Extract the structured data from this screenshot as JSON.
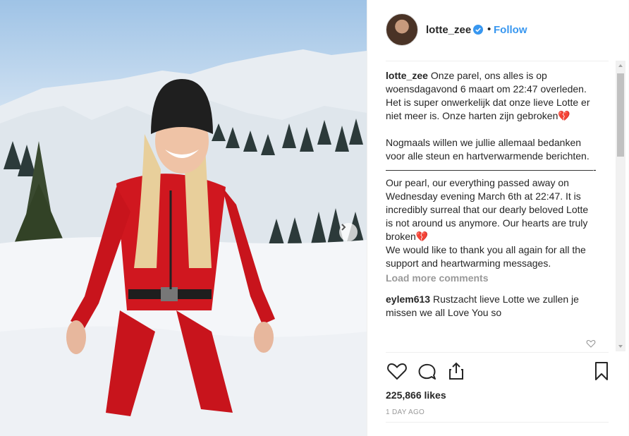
{
  "post": {
    "username": "lotte_zee",
    "follow_label": "Follow",
    "separator": "•",
    "caption": "Onze parel, ons alles is op woensdagavond 6 maart om 22:47 overleden. Het is super onwerkelijk dat onze lieve Lotte er niet meer is. Onze harten zijn gebroken💔\n\nNogmaals willen we jullie allemaal bedanken voor alle steun en hartverwarmende berichten.\n—————————————————————- Our pearl, our everything passed away on Wednesday evening March 6th at 22:47. It is incredibly surreal that our dearly beloved Lotte is not around us anymore. Our hearts are truly broken💔\nWe would like to thank you all again for all the support and heartwarming messages.",
    "load_more_label": "Load more comments",
    "comments": [
      {
        "user": "eylem613",
        "text": "Rustzacht lieve Lotte we zullen je missen we all Love You so"
      }
    ],
    "likes": "225,866 likes",
    "time_ago": "1 DAY AGO"
  },
  "icons": {
    "verified": "verified-badge-icon",
    "like": "heart-icon",
    "comment": "comment-bubble-icon",
    "share": "share-icon",
    "save": "bookmark-icon",
    "next": "chevron-right-icon"
  },
  "colors": {
    "accent": "#3897f0",
    "muted": "#999999",
    "text": "#262626"
  }
}
